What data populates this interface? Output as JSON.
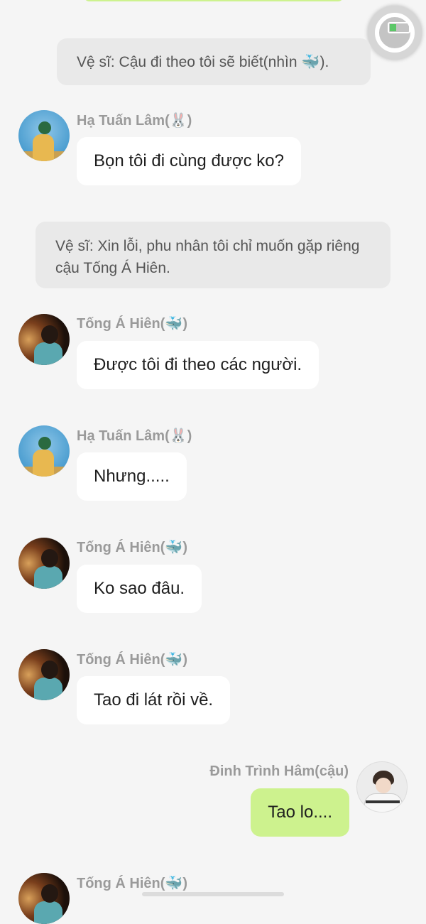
{
  "messages": {
    "narration1": "Vệ sĩ: Cậu đi theo tôi sẽ biết(nhìn 🐳).",
    "narration2": "Vệ sĩ: Xin lỗi, phu nhân tôi chỉ muốn gặp riêng cậu Tống Á Hiên.",
    "m1": {
      "sender": "Hạ Tuấn Lâm(🐰)",
      "text": "Bọn tôi đi cùng được ko?"
    },
    "m2": {
      "sender": "Tống Á Hiên(🐳)",
      "text": "Được tôi đi theo các người."
    },
    "m3": {
      "sender": "Hạ Tuấn Lâm(🐰)",
      "text": "Nhưng....."
    },
    "m4": {
      "sender": "Tống Á Hiên(🐳)",
      "text": "Ko sao đâu."
    },
    "m5": {
      "sender": "Tống Á Hiên(🐳)",
      "text": "Tao đi lát rồi về."
    },
    "m6": {
      "sender": "Đinh Trình Hâm(cậu)",
      "text": "Tao lo...."
    },
    "m7": {
      "sender": "Tống Á Hiên(🐳)"
    }
  },
  "colors": {
    "background": "#f5f5f5",
    "own_bubble": "#cdf28e",
    "other_bubble": "#ffffff",
    "narration_bg": "#e9e9e9",
    "sender_name": "#9a9a9a"
  },
  "icons": [
    "floating-assist-button-icon",
    "battery-icon"
  ]
}
